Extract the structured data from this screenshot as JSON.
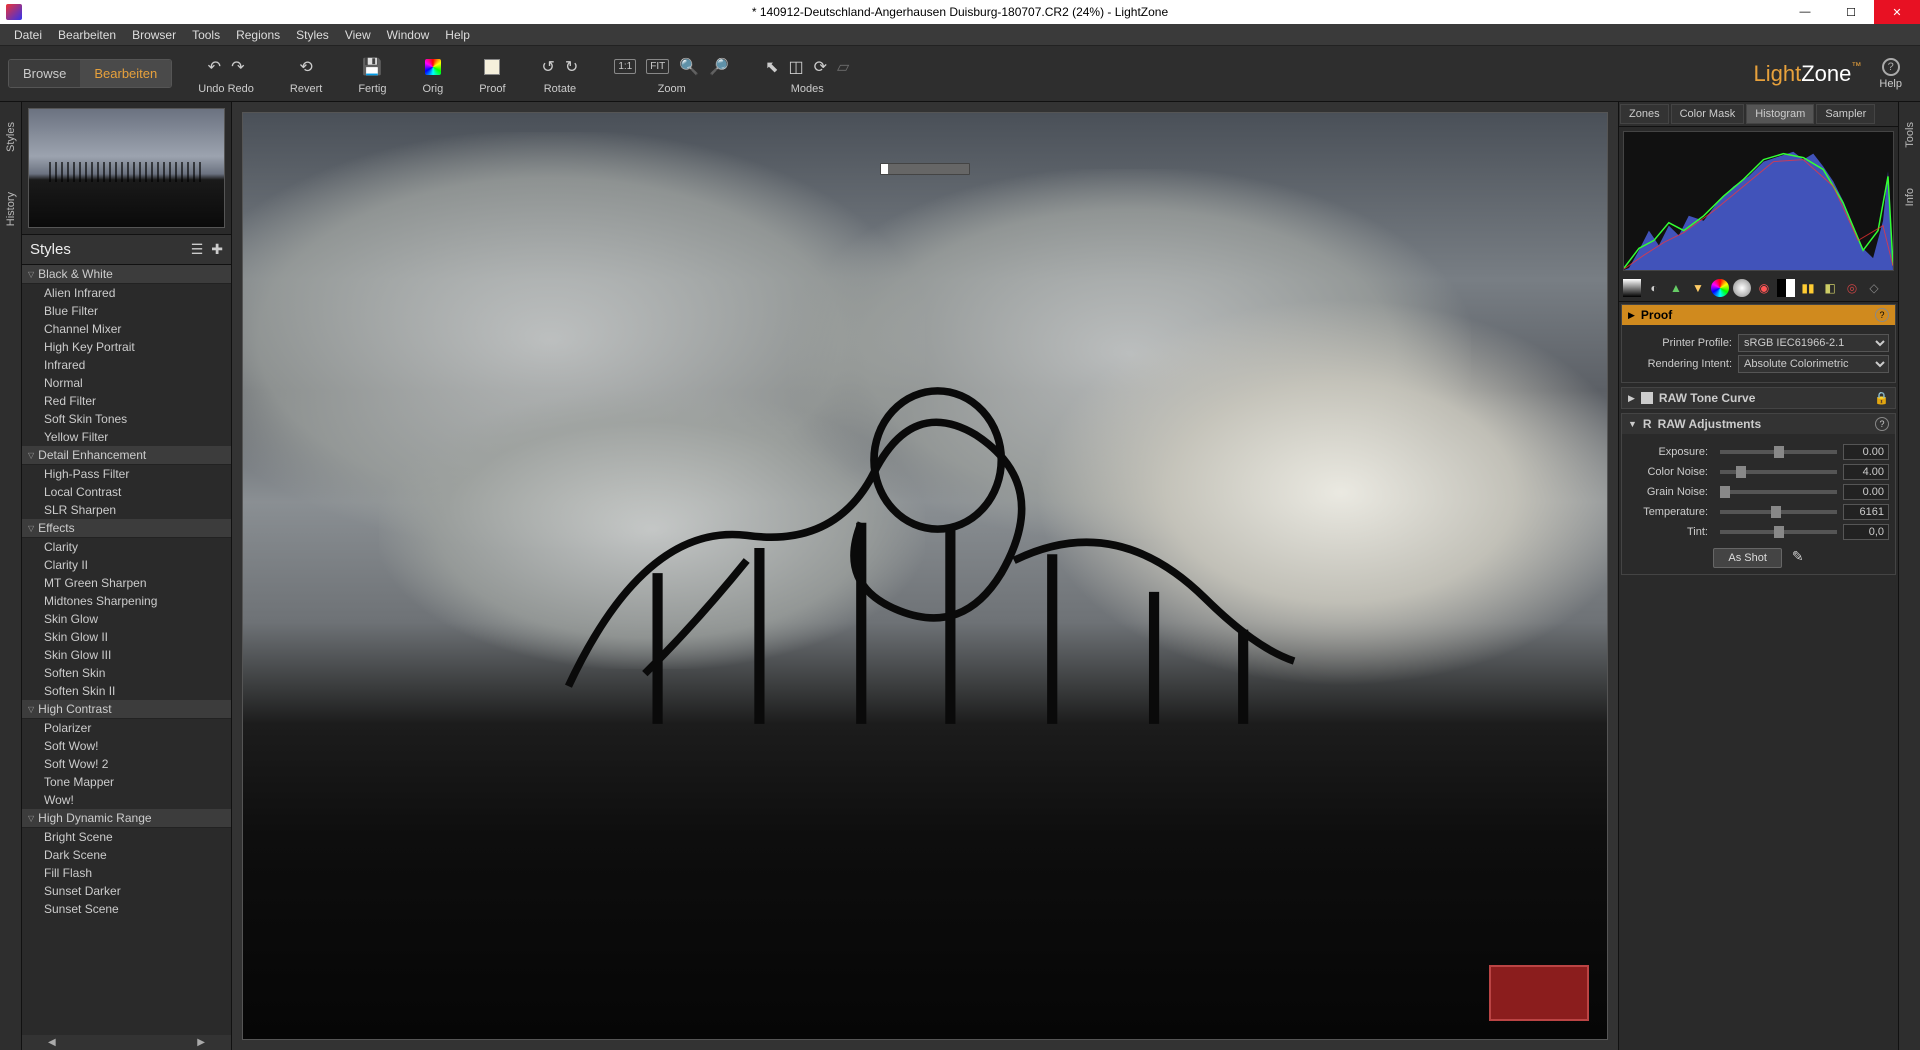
{
  "window": {
    "title": "* 140912-Deutschland-Angerhausen Duisburg-180707.CR2 (24%) - LightZone"
  },
  "menu": [
    "Datei",
    "Bearbeiten",
    "Browser",
    "Tools",
    "Regions",
    "Styles",
    "View",
    "Window",
    "Help"
  ],
  "modes": {
    "browse": "Browse",
    "edit": "Bearbeiten"
  },
  "toolbar": {
    "undoRedo": "Undo Redo",
    "revert": "Revert",
    "fertig": "Fertig",
    "orig": "Orig",
    "proof": "Proof",
    "rotate": "Rotate",
    "zoom": "Zoom",
    "modesLbl": "Modes",
    "zoom11": "1:1",
    "zoomFit": "FIT"
  },
  "logo": {
    "light": "Light",
    "zone": "Zone",
    "tm": "™"
  },
  "help": "Help",
  "leftRail": [
    "Styles",
    "History"
  ],
  "rightRail": [
    "Tools",
    "Info"
  ],
  "stylesPanel": {
    "title": "Styles"
  },
  "styles": [
    {
      "cat": "Black & White",
      "items": [
        "Alien Infrared",
        "Blue Filter",
        "Channel Mixer",
        "High Key Portrait",
        "Infrared",
        "Normal",
        "Red Filter",
        "Soft Skin Tones",
        "Yellow Filter"
      ]
    },
    {
      "cat": "Detail Enhancement",
      "items": [
        "High-Pass Filter",
        "Local Contrast",
        "SLR Sharpen"
      ]
    },
    {
      "cat": "Effects",
      "items": [
        "Clarity",
        "Clarity II",
        "MT Green Sharpen",
        "Midtones Sharpening",
        "Skin Glow",
        "Skin Glow II",
        "Skin Glow III",
        "Soften Skin",
        "Soften Skin II"
      ]
    },
    {
      "cat": "High Contrast",
      "items": [
        "Polarizer",
        "Soft Wow!",
        "Soft Wow! 2",
        "Tone Mapper",
        "Wow!"
      ]
    },
    {
      "cat": "High Dynamic Range",
      "items": [
        "Bright Scene",
        "Dark Scene",
        "Fill Flash",
        "Sunset Darker",
        "Sunset Scene"
      ]
    }
  ],
  "rightTabs": [
    "Zones",
    "Color Mask",
    "Histogram",
    "Sampler"
  ],
  "rightTabActive": 2,
  "proof": {
    "title": "Proof",
    "printerProfileLbl": "Printer Profile:",
    "printerProfile": "sRGB IEC61966-2.1",
    "renderingIntentLbl": "Rendering Intent:",
    "renderingIntent": "Absolute Colorimetric"
  },
  "rawTone": {
    "title": "RAW Tone Curve"
  },
  "rawAdj": {
    "title": "RAW Adjustments",
    "exposureLbl": "Exposure:",
    "exposure": "0.00",
    "colorNoiseLbl": "Color Noise:",
    "colorNoise": "4.00",
    "grainNoiseLbl": "Grain Noise:",
    "grainNoise": "0.00",
    "temperatureLbl": "Temperature:",
    "temperature": "6161",
    "tintLbl": "Tint:",
    "tint": "0,0",
    "asShot": "As Shot"
  }
}
